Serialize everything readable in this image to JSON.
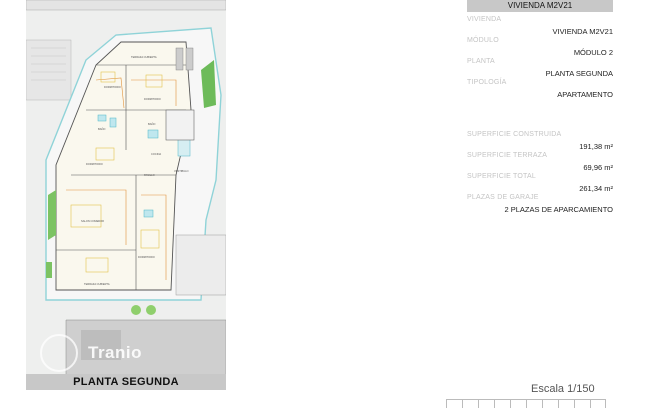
{
  "plan": {
    "caption": "PLANTA SEGUNDA",
    "watermark": "Tranio",
    "rooms": {
      "terraza_top": "TERRAZA CUBIERTA",
      "dormitorio_1": "DORMITORIO",
      "dormitorio_2": "DORMITORIO",
      "bano_1": "BAÑO",
      "bano_2": "BAÑO",
      "dormitorio_3": "DORMITORIO",
      "cocina": "COCINA",
      "pasillo": "PASILLO",
      "vestibulo": "VESTIBULO",
      "salon": "SALON COMEDOR",
      "dormitorio_4": "DORMITORIO",
      "terraza_bottom": "TERRAZA CUBIERTA"
    }
  },
  "header": "VIVIENDA M2V21",
  "fields": [
    {
      "label": "VIVIENDA",
      "value": "VIVIENDA M2V21"
    },
    {
      "label": "MÓDULO",
      "value": "MÓDULO 2"
    },
    {
      "label": "PLANTA",
      "value": "PLANTA SEGUNDA"
    },
    {
      "label": "TIPOLOGÍA",
      "value": "APARTAMENTO"
    }
  ],
  "surfaces": [
    {
      "label": "SUPERFICIE CONSTRUIDA",
      "value": "191,38 m²"
    },
    {
      "label": "SUPERFICIE TERRAZA",
      "value": "69,96 m²"
    },
    {
      "label": "SUPERFICIE TOTAL",
      "value": "261,34 m²"
    },
    {
      "label": "PLAZAS DE GARAJE",
      "value": "2 PLAZAS DE APARCAMIENTO"
    }
  ],
  "scale": "Escala 1/150"
}
